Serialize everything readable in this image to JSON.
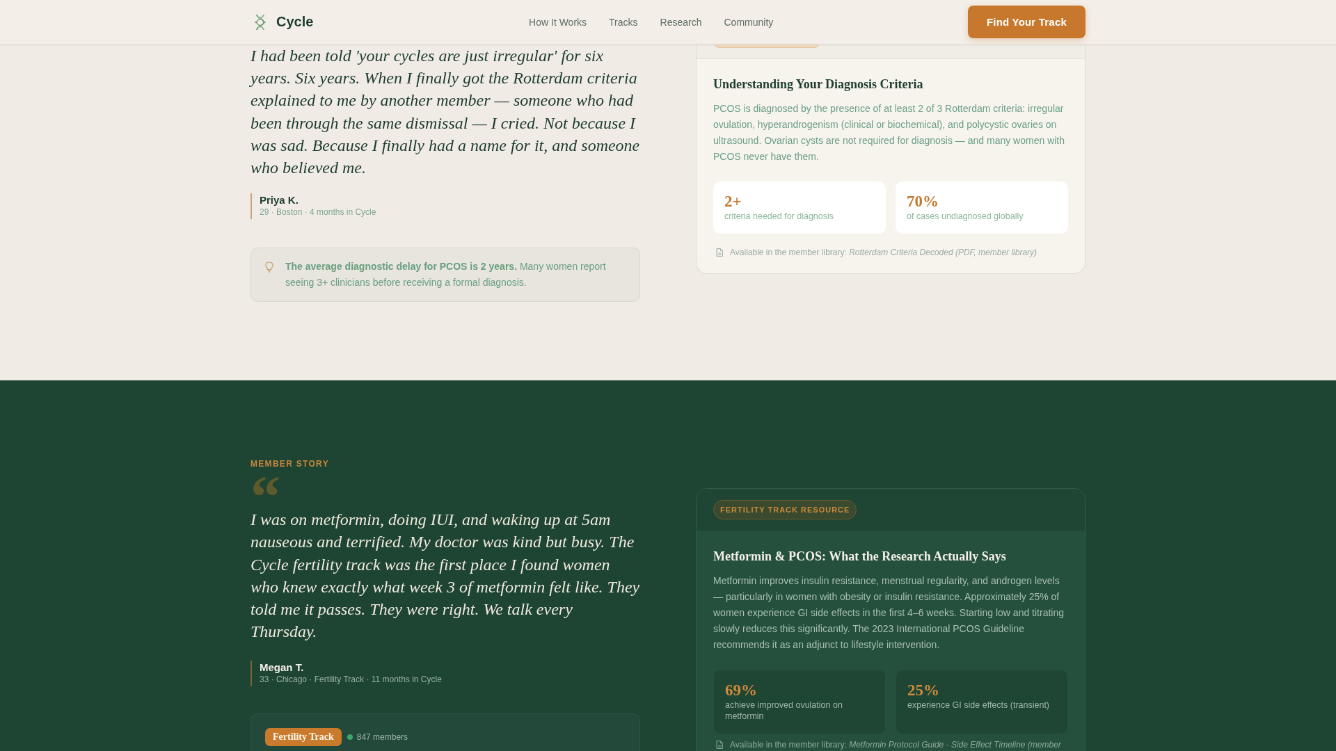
{
  "header": {
    "brand": "Cycle",
    "nav": [
      {
        "label": "How It Works"
      },
      {
        "label": "Tracks"
      },
      {
        "label": "Research"
      },
      {
        "label": "Community"
      }
    ],
    "cta": "Find Your Track"
  },
  "sections": [
    {
      "kind": "light",
      "story": {
        "quote": "I had been told 'your cycles are just irregular' for six years. Six years. When I finally got the Rotterdam criteria explained to me by another member — someone who had been through the same dismissal — I cried. Not because I was sad. Because I finally had a name for it, and someone who believed me.",
        "author": "Priya K.",
        "meta": "29 · Boston · 4 months in Cycle"
      },
      "callout": "**The average diagnostic delay for PCOS is 2 years.** Many women report seeing 3+ clinicians before receiving a formal diagnosis.",
      "resource": {
        "title": "Understanding Your Diagnosis Criteria",
        "body": "PCOS is diagnosed by the presence of at least 2 of 3 Rotterdam criteria: irregular ovulation, hyperandrogenism (clinical or biochemical), and polycystic ovaries on ultrasound. Ovarian cysts are not required for diagnosis — and many women with PCOS never have them.",
        "stats": [
          {
            "value": "2+",
            "label": "criteria needed for diagnosis"
          },
          {
            "value": "70%",
            "label": "of cases undiagnosed globally"
          }
        ],
        "library": "Available in the member library: *Rotterdam Criteria Decoded (PDF, member library)*"
      }
    },
    {
      "kind": "dark",
      "eyebrow": "MEMBER STORY",
      "quote_mark": "“",
      "story": {
        "quote": "I was on metformin, doing IUI, and waking up at 5am nauseous and terrified. My doctor was kind but busy. The Cycle fertility track was the first place I found women who knew exactly what week 3 of metformin felt like. They told me it passes. They were right. We talk every Thursday.",
        "author": "Megan T.",
        "meta": "33 · Chicago · Fertility Track · 11 months in Cycle"
      },
      "track_card": {
        "tag": "Fertility Track",
        "members": "847 members"
      },
      "resource": {
        "tag": "FERTILITY TRACK RESOURCE",
        "title": "Metformin & PCOS: What the Research Actually Says",
        "body": "Metformin improves insulin resistance, menstrual regularity, and androgen levels — particularly in women with obesity or insulin resistance. Approximately 25% of women experience GI side effects in the first 4–6 weeks. Starting low and titrating slowly reduces this significantly. The 2023 International PCOS Guideline recommends it as an adjunct to lifestyle intervention.",
        "stats": [
          {
            "value": "69%",
            "label": "achieve improved ovulation on metformin"
          },
          {
            "value": "25%",
            "label": "experience GI side effects (transient)"
          }
        ],
        "library": "Available in the member library: *Metformin Protocol Guide · Side Effect Timeline (member*"
      }
    }
  ]
}
